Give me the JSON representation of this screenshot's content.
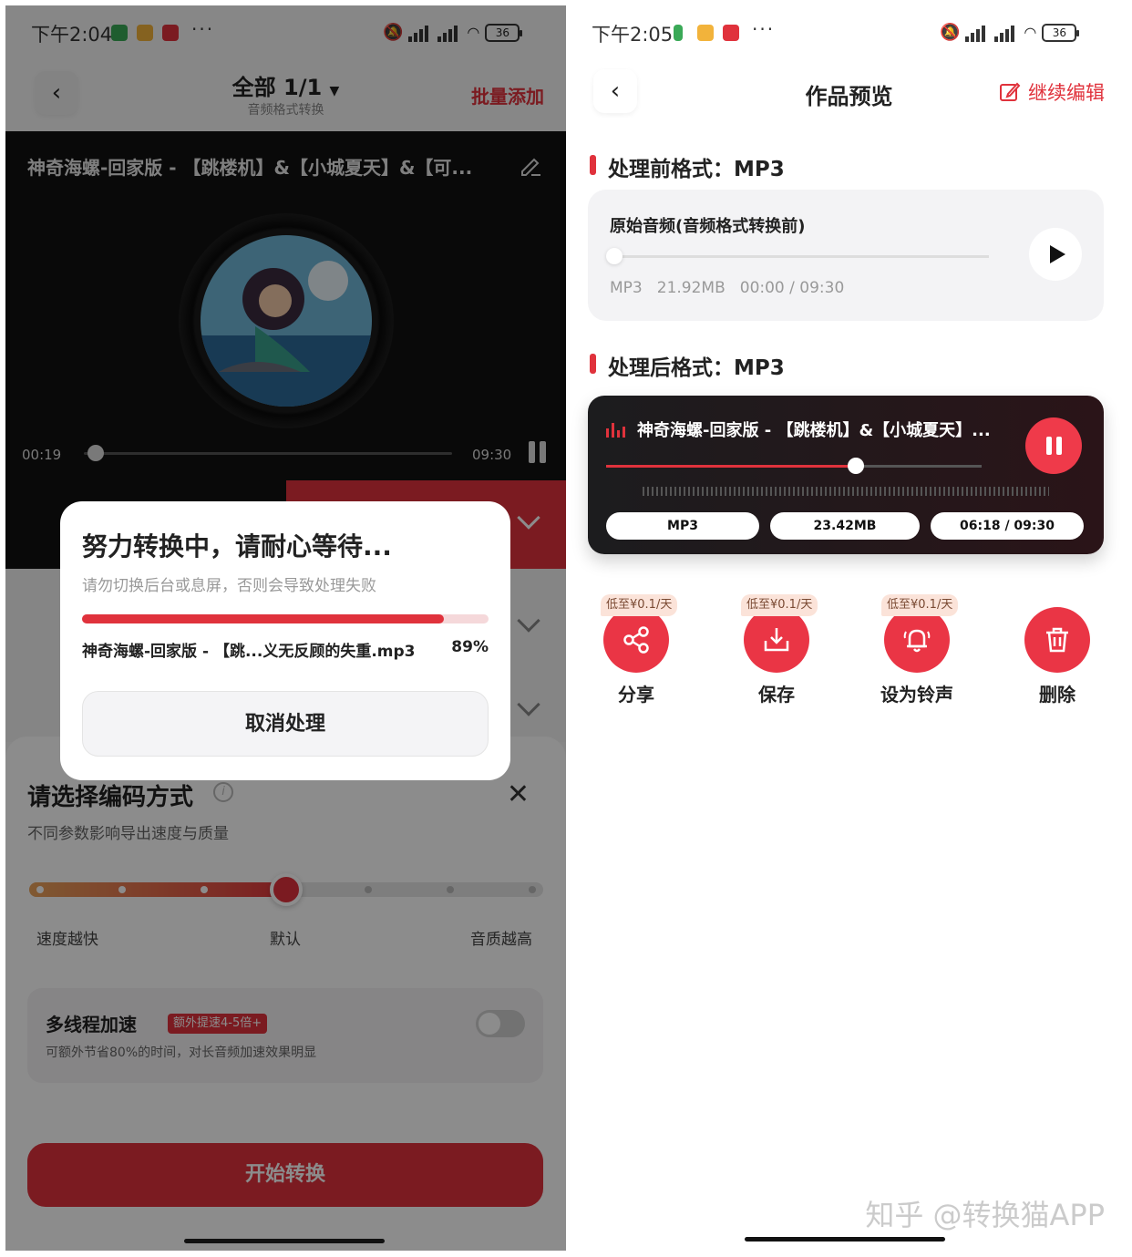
{
  "left": {
    "status": {
      "time": "下午2:04",
      "battery": "36"
    },
    "header": {
      "title": "全部 1/1",
      "subtitle": "音频格式转换",
      "batch_add": "批量添加"
    },
    "player": {
      "title": "神奇海螺-回家版 - 【跳楼机】&【小城夏天】&【可...",
      "current_time": "00:19",
      "total_time": "09:30"
    },
    "sheet": {
      "title": "请选择编码方式",
      "subtitle": "不同参数影响导出速度与质量",
      "labels": {
        "fast": "速度越快",
        "default": "默认",
        "quality": "音质越高"
      },
      "multithread": {
        "title": "多线程加速",
        "badge": "额外提速4-5倍+",
        "desc": "可额外节省80%的时间，对长音频加速效果明显",
        "enabled": false
      },
      "start_button": "开始转换"
    },
    "dialog": {
      "title": "努力转换中，请耐心等待...",
      "subtitle": "请勿切换后台或息屏，否则会导致处理失败",
      "file": "神奇海螺-回家版 - 【跳...义无反顾的失重.mp3",
      "percent": "89%",
      "progress": 0.89,
      "cancel_button": "取消处理"
    }
  },
  "right": {
    "status": {
      "time": "下午2:05",
      "battery": "36"
    },
    "header": {
      "title": "作品预览",
      "edit_label": "继续编辑"
    },
    "before": {
      "section_label": "处理前格式：MP3",
      "card_title": "原始音频(音频格式转换前)",
      "format": "MP3",
      "size": "21.92MB",
      "time": "00:00 / 09:30"
    },
    "after": {
      "section_label": "处理后格式：MP3",
      "title": "神奇海螺-回家版 - 【跳楼机】&【小城夏天】...",
      "progress": 0.665,
      "format": "MP3",
      "size": "23.42MB",
      "time": "06:18 / 09:30"
    },
    "actions": [
      {
        "label": "分享",
        "badge": "低至¥0.1/天",
        "icon": "share-icon"
      },
      {
        "label": "保存",
        "badge": "低至¥0.1/天",
        "icon": "download-icon"
      },
      {
        "label": "设为铃声",
        "badge": "低至¥0.1/天",
        "icon": "bell-icon"
      },
      {
        "label": "删除",
        "badge": "",
        "icon": "trash-icon"
      }
    ],
    "watermark": "知乎 @转换猫APP"
  },
  "colors": {
    "accent": "#e0323c",
    "dark_card": "#1c1c1e"
  }
}
